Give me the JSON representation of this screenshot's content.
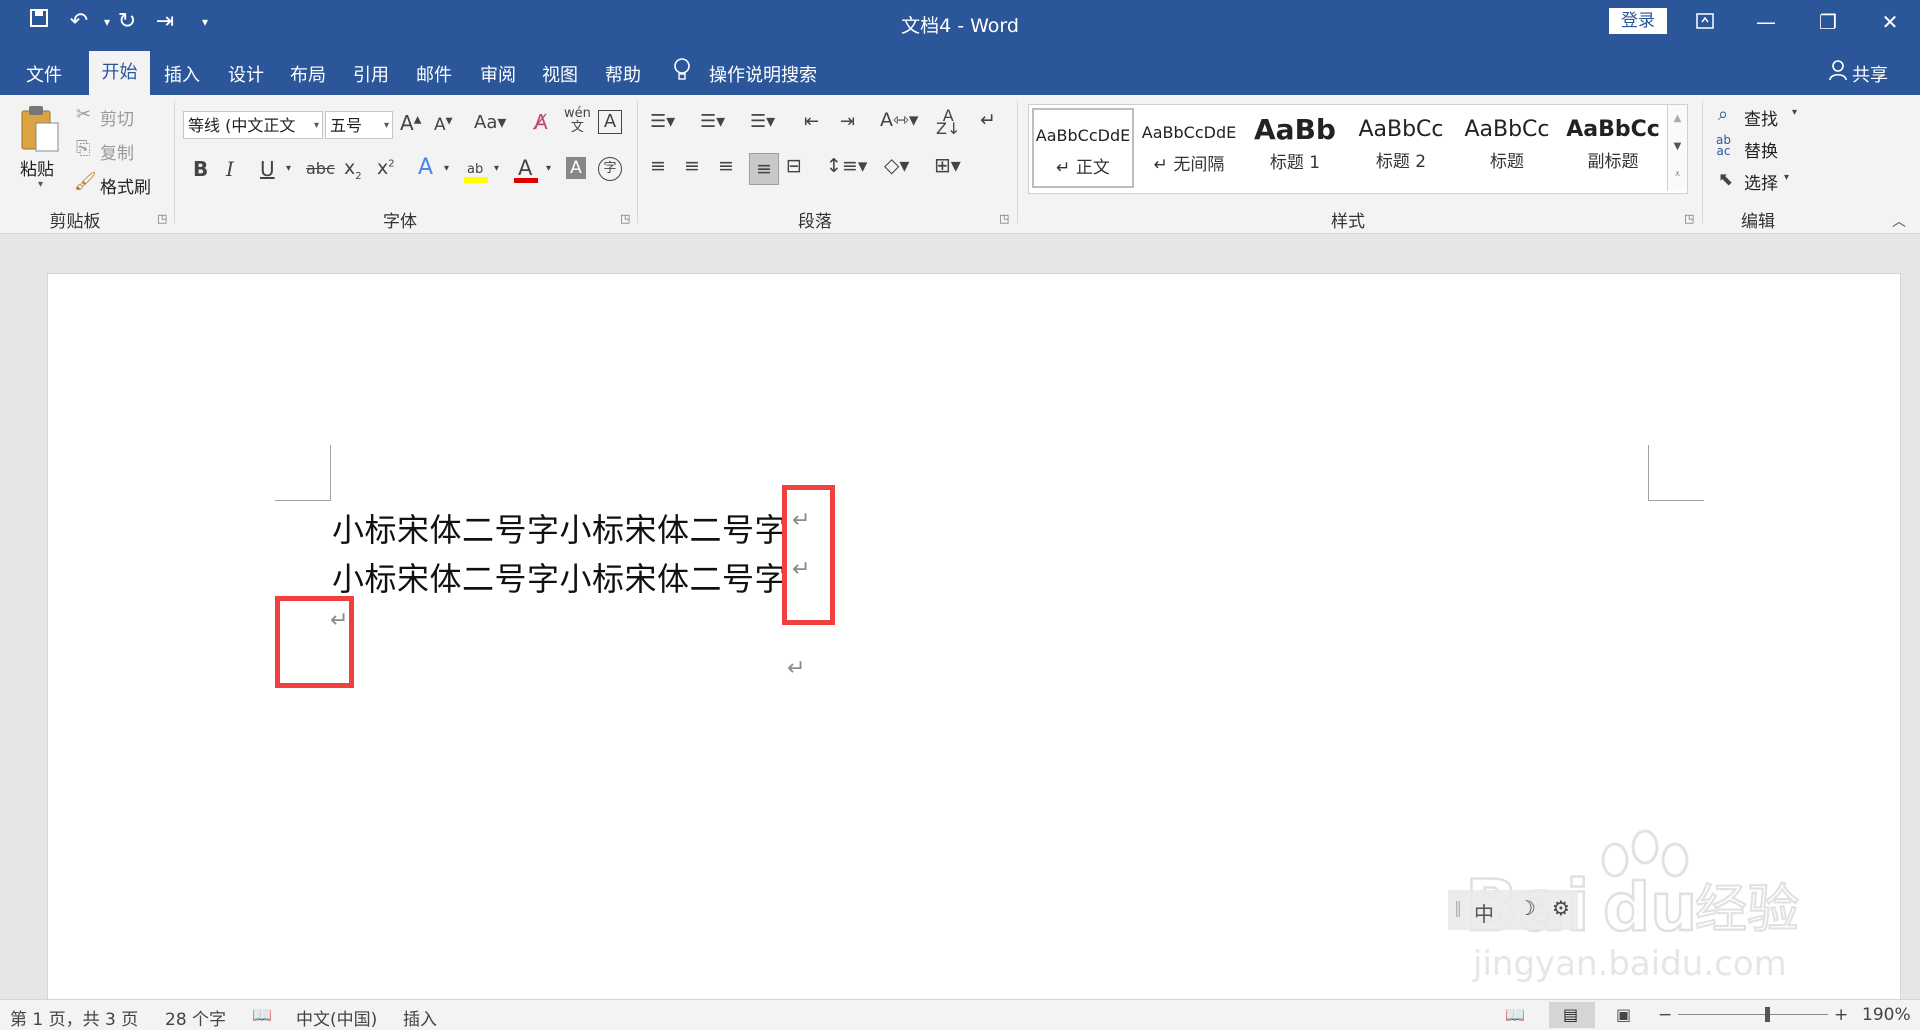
{
  "window": {
    "title": "文档4  -  Word",
    "login_label": "登录",
    "share_label": "共享"
  },
  "quick_access": [
    "save-icon",
    "undo-icon",
    "redo-icon",
    "indent-icon",
    "customize-icon"
  ],
  "menu": {
    "tabs": [
      "文件",
      "开始",
      "插入",
      "设计",
      "布局",
      "引用",
      "邮件",
      "审阅",
      "视图",
      "帮助"
    ],
    "search_label": "操作说明搜索"
  },
  "ribbon": {
    "clipboard": {
      "paste": "粘贴",
      "cut": "剪切",
      "copy": "复制",
      "format_painter": "格式刷",
      "group": "剪贴板"
    },
    "font": {
      "family": "等线 (中文正文",
      "size": "五号",
      "group": "字体"
    },
    "paragraph": {
      "group": "段落"
    },
    "styles": {
      "group": "样式",
      "items": [
        {
          "sample": "AaBbCcDdE",
          "name": "↵ 正文"
        },
        {
          "sample": "AaBbCcDdE",
          "name": "↵ 无间隔"
        },
        {
          "sample": "AaBb",
          "name": "标题 1"
        },
        {
          "sample": "AaBbCc",
          "name": "标题 2"
        },
        {
          "sample": "AaBbCc",
          "name": "标题"
        },
        {
          "sample": "AaBbCc",
          "name": "副标题"
        }
      ]
    },
    "editing": {
      "find": "查找",
      "replace": "替换",
      "select": "选择",
      "group": "编辑"
    }
  },
  "document": {
    "lines": [
      "小标宋体二号字小标宋体二号字",
      "小标宋体二号字小标宋体二号字"
    ],
    "para_mark": "↵"
  },
  "ime_toolbar": {
    "lang": "中"
  },
  "watermark": {
    "logo": "Bai du 经验",
    "url": "jingyan.baidu.com"
  },
  "status": {
    "page": "第 1 页，共 3 页",
    "words": "28 个字",
    "language": "中文(中国)",
    "mode": "插入",
    "zoom": "190%"
  },
  "colors": {
    "brand": "#2b579a",
    "highlight_box": "#f04040"
  }
}
